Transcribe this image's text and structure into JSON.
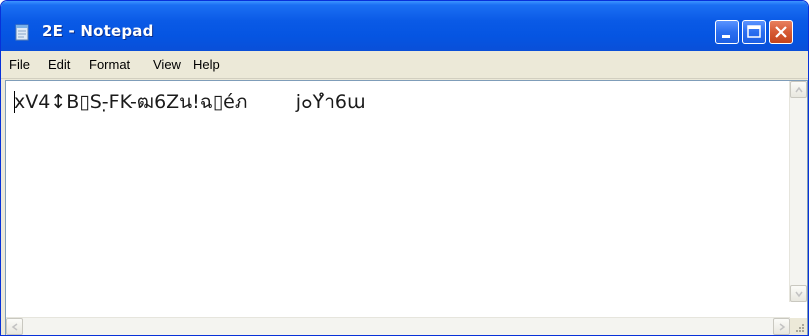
{
  "window": {
    "title": "2E - Notepad",
    "app_icon": "notepad-icon",
    "buttons": [
      "minimize-icon",
      "maximize-icon",
      "close-icon"
    ]
  },
  "menu": {
    "file": "File",
    "edit": "Edit",
    "format": "Format",
    "view": "View",
    "help": "Help"
  },
  "document": {
    "text": "xV4↕B▯S-̣FK-ฒ6Zน!ฉ▯éภ        j๐Yำ6ɯ"
  },
  "colors": {
    "title_bar": "#0a5ae6",
    "close_button": "#d65a34",
    "menu_bg": "#ece9d8",
    "editor_bg": "#ffffff"
  }
}
